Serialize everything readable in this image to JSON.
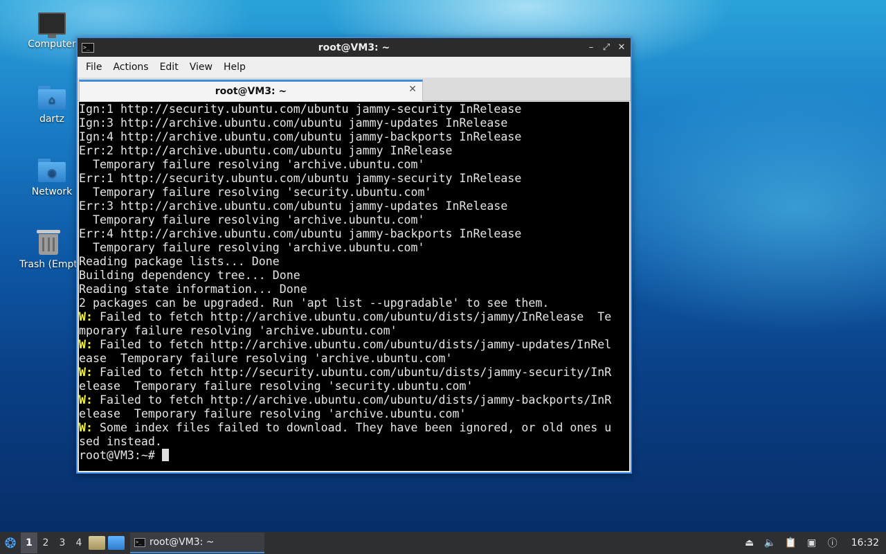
{
  "desktop": {
    "icons": [
      {
        "label": "Computer"
      },
      {
        "label": "dartz"
      },
      {
        "label": "Network"
      },
      {
        "label": "Trash (Empt"
      }
    ]
  },
  "window": {
    "title": "root@VM3: ~",
    "app_icon_glyph": ">_",
    "controls": {
      "minimize": "–",
      "maximize": "⤢",
      "close": "✕"
    },
    "menu": [
      "File",
      "Actions",
      "Edit",
      "View",
      "Help"
    ],
    "tab": {
      "label": "root@VM3: ~",
      "close": "✕"
    }
  },
  "terminal": {
    "lines": [
      {
        "prefix": "",
        "text": "Ign:1 http://security.ubuntu.com/ubuntu jammy-security InRelease"
      },
      {
        "prefix": "",
        "text": "Ign:3 http://archive.ubuntu.com/ubuntu jammy-updates InRelease"
      },
      {
        "prefix": "",
        "text": "Ign:4 http://archive.ubuntu.com/ubuntu jammy-backports InRelease"
      },
      {
        "prefix": "",
        "text": "Err:2 http://archive.ubuntu.com/ubuntu jammy InRelease"
      },
      {
        "prefix": "",
        "text": "  Temporary failure resolving 'archive.ubuntu.com'"
      },
      {
        "prefix": "",
        "text": "Err:1 http://security.ubuntu.com/ubuntu jammy-security InRelease"
      },
      {
        "prefix": "",
        "text": "  Temporary failure resolving 'security.ubuntu.com'"
      },
      {
        "prefix": "",
        "text": "Err:3 http://archive.ubuntu.com/ubuntu jammy-updates InRelease"
      },
      {
        "prefix": "",
        "text": "  Temporary failure resolving 'archive.ubuntu.com'"
      },
      {
        "prefix": "",
        "text": "Err:4 http://archive.ubuntu.com/ubuntu jammy-backports InRelease"
      },
      {
        "prefix": "",
        "text": "  Temporary failure resolving 'archive.ubuntu.com'"
      },
      {
        "prefix": "",
        "text": "Reading package lists... Done"
      },
      {
        "prefix": "",
        "text": "Building dependency tree... Done"
      },
      {
        "prefix": "",
        "text": "Reading state information... Done"
      },
      {
        "prefix": "",
        "text": "2 packages can be upgraded. Run 'apt list --upgradable' to see them."
      },
      {
        "prefix": "W:",
        "text": " Failed to fetch http://archive.ubuntu.com/ubuntu/dists/jammy/InRelease  Te"
      },
      {
        "prefix": "",
        "text": "mporary failure resolving 'archive.ubuntu.com'"
      },
      {
        "prefix": "W:",
        "text": " Failed to fetch http://archive.ubuntu.com/ubuntu/dists/jammy-updates/InRel"
      },
      {
        "prefix": "",
        "text": "ease  Temporary failure resolving 'archive.ubuntu.com'"
      },
      {
        "prefix": "W:",
        "text": " Failed to fetch http://security.ubuntu.com/ubuntu/dists/jammy-security/InR"
      },
      {
        "prefix": "",
        "text": "elease  Temporary failure resolving 'security.ubuntu.com'"
      },
      {
        "prefix": "W:",
        "text": " Failed to fetch http://archive.ubuntu.com/ubuntu/dists/jammy-backports/InR"
      },
      {
        "prefix": "",
        "text": "elease  Temporary failure resolving 'archive.ubuntu.com'"
      },
      {
        "prefix": "W:",
        "text": " Some index files failed to download. They have been ignored, or old ones u"
      },
      {
        "prefix": "",
        "text": "sed instead."
      }
    ],
    "prompt": "root@VM3:~# "
  },
  "taskbar": {
    "desktops": [
      "1",
      "2",
      "3",
      "4"
    ],
    "active_desktop": "1",
    "task_label": "root@VM3: ~",
    "task_icon_glyph": ">_",
    "clock": "16:32"
  },
  "colors": {
    "accent": "#3d8ee0",
    "warning_prefix": "#f2f24a",
    "terminal_bg": "#000000"
  }
}
